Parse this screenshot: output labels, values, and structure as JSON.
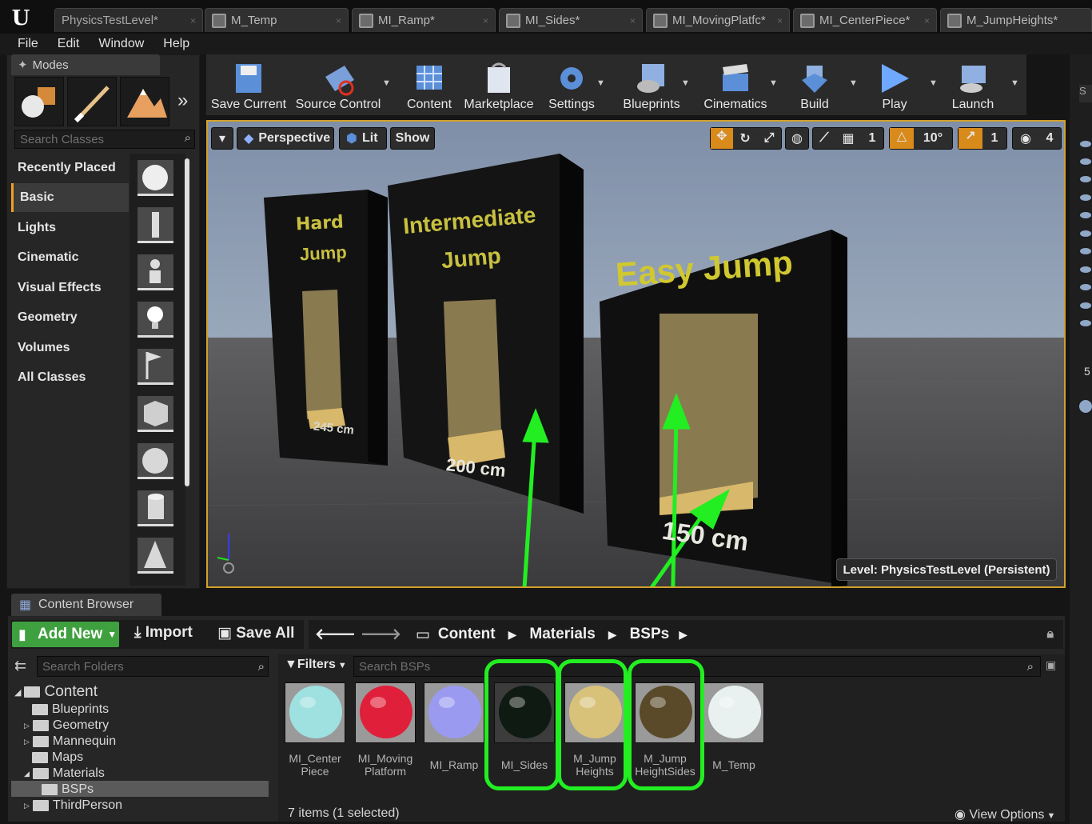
{
  "tabs": [
    {
      "label": "PhysicsTestLevel*"
    },
    {
      "label": "M_Temp"
    },
    {
      "label": "MI_Ramp*"
    },
    {
      "label": "MI_Sides*"
    },
    {
      "label": "MI_MovingPlatfc*"
    },
    {
      "label": "MI_CenterPiece*"
    },
    {
      "label": "M_JumpHeights*"
    }
  ],
  "menu": [
    "File",
    "Edit",
    "Window",
    "Help"
  ],
  "modes": {
    "title": "Modes",
    "search_placeholder": "Search Classes",
    "categories": [
      "Recently Placed",
      "Basic",
      "Lights",
      "Cinematic",
      "Visual Effects",
      "Geometry",
      "Volumes",
      "All Classes"
    ],
    "selected_category": "Basic"
  },
  "toolbar": {
    "buttons": [
      {
        "label": "Save Current",
        "icon": "save-icon"
      },
      {
        "label": "Source Control",
        "icon": "source-control-icon"
      },
      {
        "label": "Content",
        "icon": "content-icon"
      },
      {
        "label": "Marketplace",
        "icon": "marketplace-icon"
      },
      {
        "label": "Settings",
        "icon": "settings-icon"
      },
      {
        "label": "Blueprints",
        "icon": "blueprints-icon"
      },
      {
        "label": "Cinematics",
        "icon": "cinematics-icon"
      },
      {
        "label": "Build",
        "icon": "build-icon"
      },
      {
        "label": "Play",
        "icon": "play-icon"
      },
      {
        "label": "Launch",
        "icon": "launch-icon"
      }
    ]
  },
  "viewport": {
    "perspective": "Perspective",
    "lit": "Lit",
    "show": "Show",
    "grid_snap": "1",
    "rotation_snap": "10°",
    "scale_snap": "1",
    "camera_speed": "4",
    "level_label": "Level:  PhysicsTestLevel (Persistent)",
    "scene": {
      "hard": [
        "Hard",
        "Jump",
        "245 cm"
      ],
      "intermediate": [
        "Intermediate",
        "Jump",
        "200 cm"
      ],
      "easy": [
        "Easy Jump",
        "150 cm"
      ]
    },
    "highlight_color": "#22ee22"
  },
  "content_browser": {
    "title": "Content Browser",
    "add_new": "Add New",
    "import": "Import",
    "save_all": "Save All",
    "breadcrumb": [
      "Content",
      "Materials",
      "BSPs"
    ],
    "search_folders_placeholder": "Search Folders",
    "filters": "Filters",
    "search_assets_placeholder": "Search BSPs",
    "folders": [
      {
        "name": "Content",
        "level": 0
      },
      {
        "name": "Blueprints",
        "level": 1
      },
      {
        "name": "Geometry",
        "level": 1
      },
      {
        "name": "Mannequin",
        "level": 1
      },
      {
        "name": "Maps",
        "level": 1
      },
      {
        "name": "Materials",
        "level": 1
      },
      {
        "name": "BSPs",
        "level": 2,
        "selected": true
      },
      {
        "name": "ThirdPerson",
        "level": 1
      }
    ],
    "assets": [
      {
        "name": "MI_Center Piece",
        "line1": "MI_Center",
        "line2": "Piece",
        "color": "#9fe0e0"
      },
      {
        "name": "MI_Moving Platform",
        "line1": "MI_Moving",
        "line2": "Platform",
        "color": "#e0203a"
      },
      {
        "name": "MI_Ramp",
        "line1": "MI_Ramp",
        "line2": "",
        "color": "#9a9af0"
      },
      {
        "name": "MI_Sides",
        "line1": "MI_Sides",
        "line2": "",
        "color": "#0e1a12",
        "selected": true
      },
      {
        "name": "M_Jump Heights",
        "line1": "M_Jump",
        "line2": "Heights",
        "color": "#d8c27a"
      },
      {
        "name": "M_Jump HeightSides",
        "line1": "M_Jump",
        "line2": "HeightSides",
        "color": "#5a4a2a"
      },
      {
        "name": "M_Temp",
        "line1": "M_Temp",
        "line2": "",
        "color": "#e8f0f0"
      }
    ],
    "status": "7 items (1 selected)",
    "view_options": "View Options"
  }
}
